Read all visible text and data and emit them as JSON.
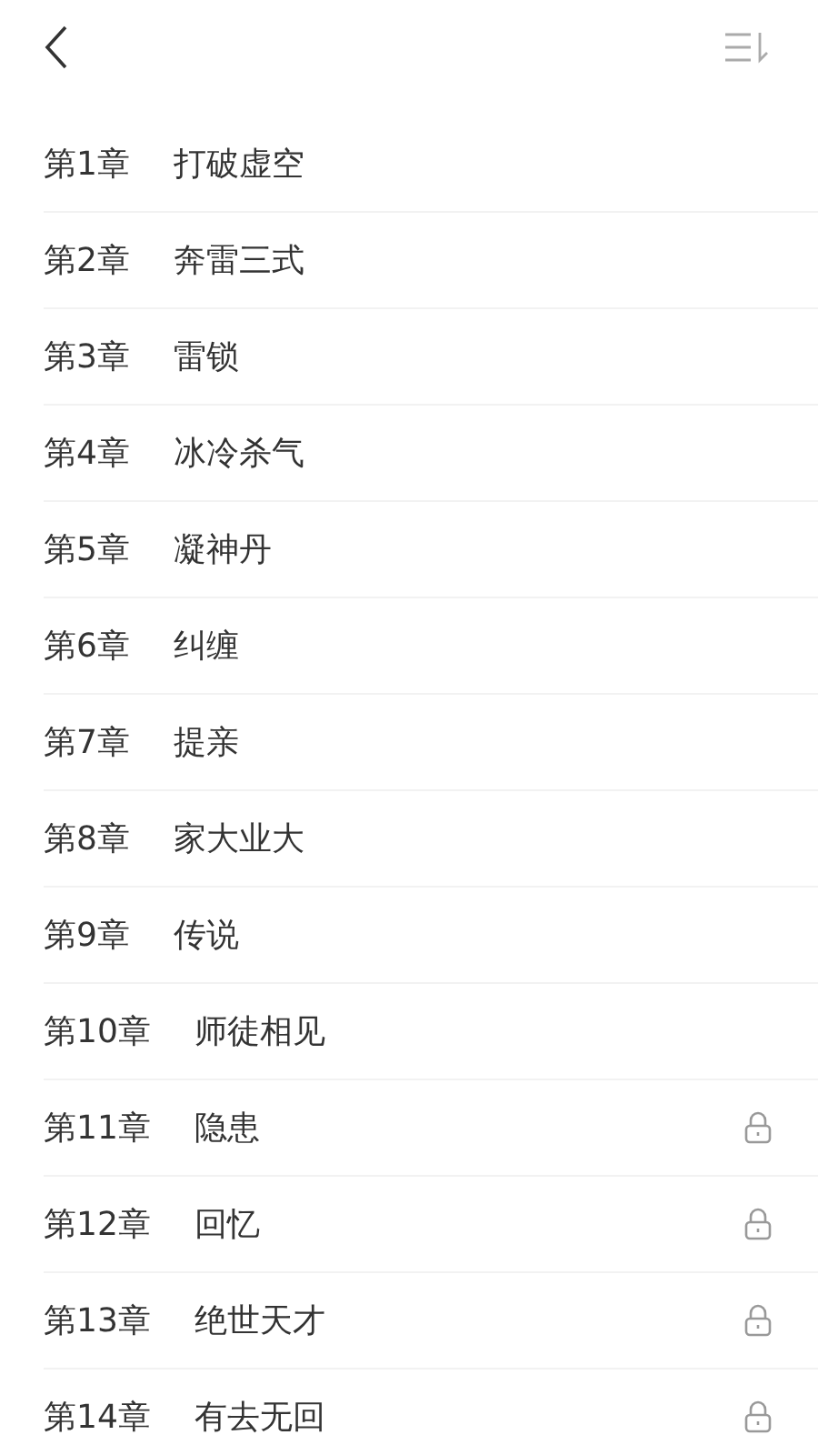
{
  "chapters": [
    {
      "number": "第1章",
      "title": "打破虚空",
      "locked": false
    },
    {
      "number": "第2章",
      "title": "奔雷三式",
      "locked": false
    },
    {
      "number": "第3章",
      "title": "雷锁",
      "locked": false
    },
    {
      "number": "第4章",
      "title": "冰冷杀气",
      "locked": false
    },
    {
      "number": "第5章",
      "title": "凝神丹",
      "locked": false
    },
    {
      "number": "第6章",
      "title": "纠缠",
      "locked": false
    },
    {
      "number": "第7章",
      "title": "提亲",
      "locked": false
    },
    {
      "number": "第8章",
      "title": "家大业大",
      "locked": false
    },
    {
      "number": "第9章",
      "title": "传说",
      "locked": false
    },
    {
      "number": "第10章",
      "title": "师徒相见",
      "locked": false
    },
    {
      "number": "第11章",
      "title": "隐患",
      "locked": true
    },
    {
      "number": "第12章",
      "title": "回忆",
      "locked": true
    },
    {
      "number": "第13章",
      "title": "绝世天才",
      "locked": true
    },
    {
      "number": "第14章",
      "title": "有去无回",
      "locked": true
    }
  ]
}
